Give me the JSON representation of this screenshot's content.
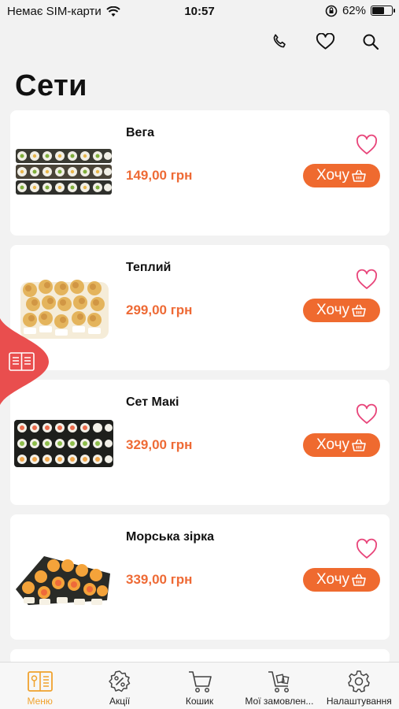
{
  "status_bar": {
    "carrier": "Немає SIM-карти",
    "time": "10:57",
    "battery": "62%",
    "battery_level": 0.62
  },
  "header": {
    "title": "Сети",
    "icons": [
      "phone-icon",
      "heart-icon",
      "search-icon"
    ]
  },
  "products": [
    {
      "name": "Вега",
      "price": "149,00 грн",
      "button": "Хочу"
    },
    {
      "name": "Теплий",
      "price": "299,00 грн",
      "button": "Хочу"
    },
    {
      "name": "Сет Макі",
      "price": "329,00 грн",
      "button": "Хочу"
    },
    {
      "name": "Морська зірка",
      "price": "339,00 грн",
      "button": "Хочу"
    }
  ],
  "tab_bar": [
    {
      "label": "Меню",
      "icon": "menu-book-icon",
      "active": true
    },
    {
      "label": "Акції",
      "icon": "discount-icon",
      "active": false
    },
    {
      "label": "Кошик",
      "icon": "cart-icon",
      "active": false
    },
    {
      "label": "Мої замовлен...",
      "icon": "orders-cart-icon",
      "active": false
    },
    {
      "label": "Налаштування",
      "icon": "gear-icon",
      "active": false
    }
  ],
  "colors": {
    "accent": "#ef6a2f",
    "active_tab": "#f0a22d",
    "heart": "#e8457a",
    "flap": "#e94e4e"
  }
}
